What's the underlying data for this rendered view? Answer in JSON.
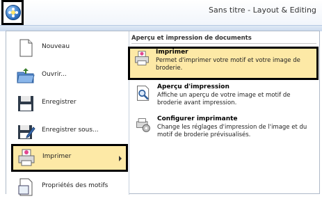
{
  "window": {
    "title": "Sans titre - Layout & Editing"
  },
  "menu": {
    "left_items": [
      {
        "label": "Nouveau",
        "icon": "new-document-icon"
      },
      {
        "label": "Ouvrir...",
        "icon": "open-folder-icon"
      },
      {
        "label": "Enregistrer",
        "icon": "save-icon"
      },
      {
        "label": "Enregistrer sous...",
        "icon": "save-as-icon"
      },
      {
        "label": "Imprimer",
        "icon": "printer-icon"
      },
      {
        "label": "Propriétés des motifs",
        "icon": "pattern-properties-icon"
      }
    ],
    "right_header": "Aperçu et impression de documents",
    "right_items": [
      {
        "title": "Imprimer",
        "desc": "Permet d'imprimer votre motif et votre image de broderie.",
        "icon": "printer-icon"
      },
      {
        "title": "Aperçu d'impression",
        "desc": "Affiche un aperçu de votre image et motif de broderie avant impression.",
        "icon": "print-preview-icon"
      },
      {
        "title": "Configurer imprimante",
        "desc": "Change les réglages d'impression de l'image et du motif de broderie prévisualisés.",
        "icon": "printer-setup-icon"
      }
    ]
  }
}
